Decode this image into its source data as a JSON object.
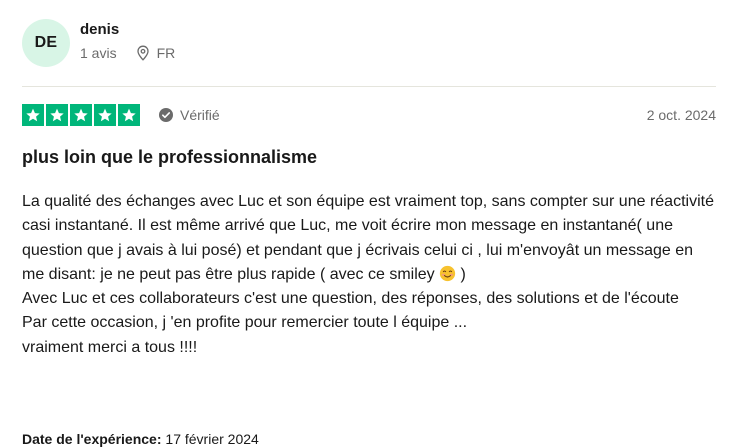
{
  "reviewer": {
    "initials": "DE",
    "name": "denis",
    "review_count": "1 avis",
    "country": "FR"
  },
  "review": {
    "rating": 5,
    "rating_max": 5,
    "verified_label": "Vérifié",
    "date": "2 oct. 2024",
    "title": "plus loin que le professionnalisme",
    "body": {
      "line1": "La qualité des échanges avec Luc et son équipe est vraiment top, sans compter sur une réactivité casi instantané. Il est même arrivé que Luc, me voit écrire mon message en instantané( une question que j avais à lui posé) et pendant que j écrivais celui ci , lui m'envoyât un message en me disant: je ne peut pas être plus rapide ( avec ce smiley ",
      "line1_end": " )",
      "line2": "Avec Luc et ces collaborateurs c'est une question, des réponses, des solutions et de l'écoute",
      "line3": "Par cette occasion, j 'en profite pour remercier toute l équipe ...",
      "line4": "vraiment merci a tous !!!!"
    },
    "experience_label": "Date de l'expérience:",
    "experience_date": "17 février 2024"
  },
  "colors": {
    "star_green": "#00b67a",
    "avatar_bg": "#d8f5e6",
    "muted_text": "#6b6b6b",
    "divider": "#e5e5dd"
  },
  "icons": {
    "location": "map-pin-icon",
    "verified": "check-circle-icon",
    "star": "star-icon",
    "emoji": "smiling-face-emoji"
  }
}
